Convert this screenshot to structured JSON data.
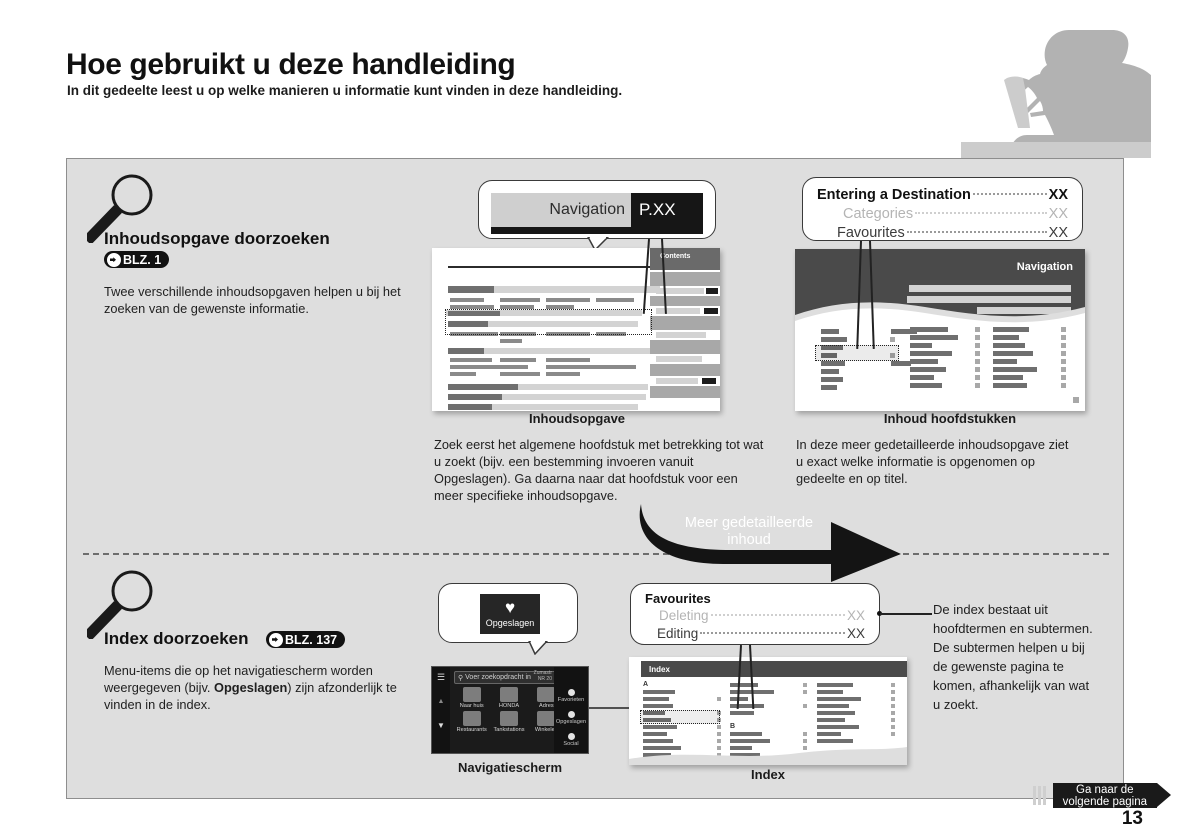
{
  "header": {
    "title": "Hoe gebruikt u deze handleiding",
    "subtitle": "In dit gedeelte leest u op welke manieren u informatie kunt vinden in deze handleiding.",
    "illustration": "person-reading-book-silhouette"
  },
  "sections": [
    {
      "id": "toc-search",
      "icon": "magnifier-icon",
      "heading": "Inhoudsopgave doorzoeken",
      "page_ref": "BLZ. 1",
      "body": "Twee verschillende inhoudsopgaven helpen u bij het zoeken van de gewenste informatie.",
      "banner": {
        "title": "Navigation",
        "page": "P.XX"
      },
      "arrow_label_line1": "Meer gedetailleerde",
      "arrow_label_line2": "inhoud",
      "left_caption": "Inhoudsopgave",
      "right_caption": "Inhoud hoofdstukken",
      "left_body": "Zoek eerst het algemene hoofdstuk met betrekking tot wat u zoekt (bijv. een bestemming invoeren vanuit Opgeslagen). Ga daarna naar dat hoofdstuk voor een meer specifieke inhoudsopgave.",
      "right_body": "In deze meer gedetailleerde inhoudsopgave ziet u exact welke informatie is opgenomen op gedeelte en op titel.",
      "toc_entries": [
        {
          "level": 1,
          "text": "Entering a Destination",
          "page": "XX"
        },
        {
          "level": 2,
          "text": "Categories",
          "page": "XX"
        },
        {
          "level": 3,
          "text": "Favourites",
          "page": "XX"
        }
      ],
      "mock_labels": {
        "contents_tab": "Contents",
        "nav_header": "Navigation"
      }
    },
    {
      "id": "index-search",
      "icon": "magnifier-icon",
      "heading": "Index doorzoeken",
      "page_ref": "BLZ. 137",
      "body_before": "Menu-items die op het navigatiescherm worden weergegeven (bijv. ",
      "body_bold": "Opgeslagen",
      "body_after": ") zijn afzonderlijk te vinden in de index.",
      "saved_tile": {
        "icon": "heart-icon",
        "label": "Opgeslagen"
      },
      "nav_screen_caption": "Navigatiescherm",
      "index_caption": "Index",
      "index_header_label": "Index",
      "index_letters": [
        "A",
        "B"
      ],
      "toc_entries": [
        {
          "level": 1,
          "text": "Favourites",
          "page": ""
        },
        {
          "level": 2,
          "text": "Deleting",
          "page": "XX"
        },
        {
          "level": 3,
          "text": "Editing",
          "page": "XX"
        }
      ],
      "right_body": "De index bestaat uit hoofdtermen en subtermen. De subtermen helpen u bij de gewenste pagina te komen, afhankelijk van wat u zoekt."
    }
  ],
  "nav_screen": {
    "menu_icon": "hamburger-menu-icon",
    "search_icon": "search-icon",
    "search_placeholder": "Voer zoekopdracht in",
    "corner_label": "Zumastr\nNR 20",
    "tiles": [
      {
        "icon": "home-icon",
        "label": "Naar huis"
      },
      {
        "icon": "honda-logo-icon",
        "label": "HONDA"
      },
      {
        "icon": "address-icon",
        "label": "Adres"
      },
      {
        "icon": "restaurant-icon",
        "label": "Restaurants"
      },
      {
        "icon": "fuel-pump-icon",
        "label": "Tankstations"
      },
      {
        "icon": "shopping-bag-icon",
        "label": "Winkelen"
      }
    ],
    "side_items": [
      {
        "icon": "star-icon",
        "label": "Favorieten"
      },
      {
        "icon": "bookmark-icon",
        "label": "Opgeslagen"
      },
      {
        "icon": "social-icon",
        "label": "Social"
      }
    ]
  },
  "footer": {
    "next_page_line1": "Ga naar de",
    "next_page_line2": "volgende pagina",
    "next_page_icon": "right-arrow-icon",
    "page_number": "13"
  },
  "colors": {
    "panel_bg": "#dedede",
    "panel_border": "#8e8e8e",
    "accent_dark": "#1a1a1a",
    "muted_text": "#b4b4b4",
    "bar_grey": "#8a8a8a",
    "header_grey": "#4a4a4a"
  }
}
